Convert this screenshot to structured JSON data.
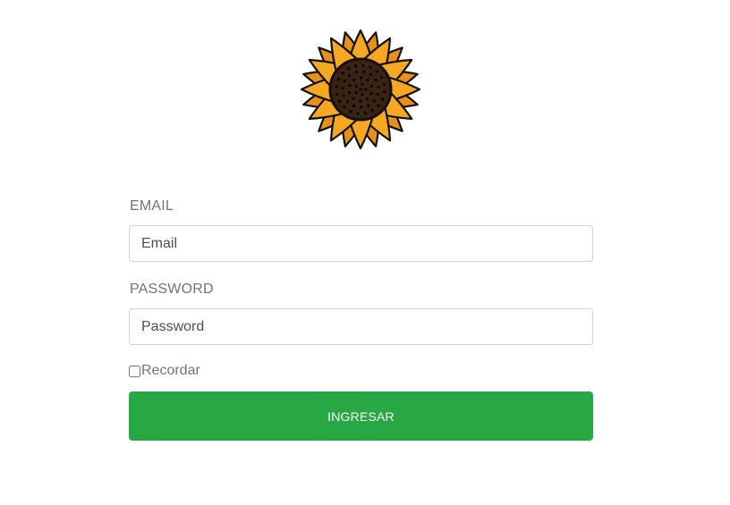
{
  "logo": {
    "icon": "sunflower-icon",
    "petal_color": "#f7a823",
    "center_color": "#3b2314"
  },
  "form": {
    "email_label": "EMAIL",
    "email_placeholder": "Email",
    "email_value": "",
    "password_label": "PASSWORD",
    "password_placeholder": "Password",
    "password_value": "",
    "remember_label": "Recordar",
    "remember_checked": false,
    "submit_label": "INGRESAR"
  },
  "colors": {
    "submit_bg": "#28a745",
    "label_text": "#6c757d",
    "input_border": "#ced4da"
  }
}
